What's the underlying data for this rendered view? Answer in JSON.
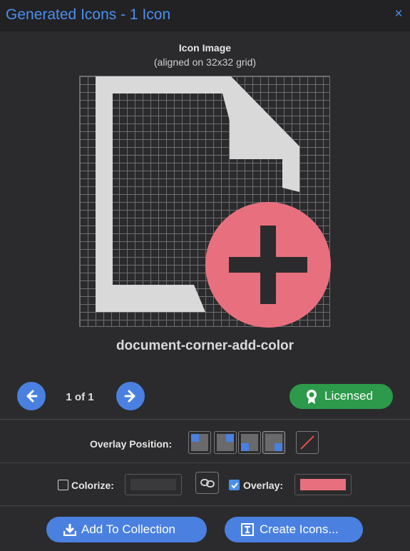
{
  "dialog": {
    "title": "Generated Icons - 1 Icon",
    "close_label": "×"
  },
  "preview": {
    "heading": "Icon Image",
    "subheading": "(aligned on 32x32 grid)",
    "icon_name": "document-corner-add-color",
    "overlay_color": "#e8707e",
    "icon_color": "#d9d9d9"
  },
  "navigation": {
    "prev_icon": "arrow-left-icon",
    "next_icon": "arrow-right-icon",
    "pager_text": "1 of 1"
  },
  "license": {
    "label": "Licensed",
    "icon": "award-icon",
    "color": "#2c9a4a"
  },
  "overlay_position": {
    "label": "Overlay Position:",
    "options": [
      "top-left",
      "top-right",
      "bottom-left",
      "bottom-right",
      "none"
    ],
    "selected": "bottom-right"
  },
  "colorize": {
    "label": "Colorize:",
    "checked": false,
    "color": "#2e2e30"
  },
  "overlay": {
    "label": "Overlay:",
    "checked": true,
    "color": "#e8707e"
  },
  "actions": {
    "add_to_collection": "Add To Collection",
    "create_icons": "Create Icons..."
  },
  "accent_color": "#4a80e0"
}
